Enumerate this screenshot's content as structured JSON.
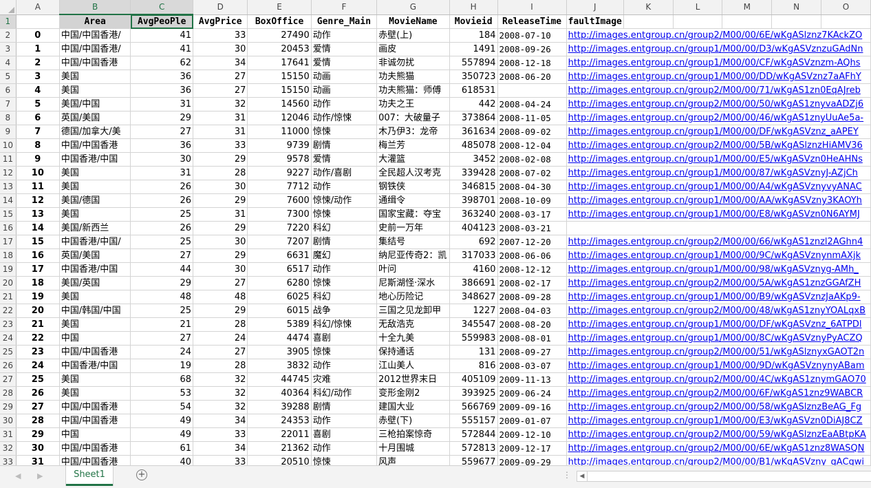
{
  "column_letters": [
    "A",
    "B",
    "C",
    "D",
    "E",
    "F",
    "G",
    "H",
    "I",
    "J",
    "K",
    "L",
    "M",
    "N",
    "O"
  ],
  "header_row": {
    "row_number": "1",
    "cells": [
      "",
      "Area",
      "AvgPeoPle",
      "AvgPrice",
      "BoxOffice",
      "Genre_Main",
      "MovieName",
      "Movieid",
      "ReleaseTime",
      "faultImage"
    ]
  },
  "rows": [
    {
      "r": "2",
      "idx": "0",
      "area": "中国/中国香港/",
      "ppl": "41",
      "price": "33",
      "box": "27490",
      "genre": "动作",
      "name": "赤壁(上)",
      "id": "184",
      "date": "2008-07-10",
      "img": "http://images.entgroup.cn/group2/M00/00/6E/wKgASlznz7KAckZO"
    },
    {
      "r": "3",
      "idx": "1",
      "area": "中国/中国香港/",
      "ppl": "41",
      "price": "30",
      "box": "20453",
      "genre": "爱情",
      "name": "画皮",
      "id": "1491",
      "date": "2008-09-26",
      "img": "http://images.entgroup.cn/group1/M00/00/D3/wKgASVznzuGAdNn"
    },
    {
      "r": "4",
      "idx": "2",
      "area": "中国/中国香港",
      "ppl": "62",
      "price": "34",
      "box": "17641",
      "genre": "爱情",
      "name": "非诚勿扰",
      "id": "557894",
      "date": "2008-12-18",
      "img": "http://images.entgroup.cn/group1/M00/00/CF/wKgASVznzm-AQhs"
    },
    {
      "r": "5",
      "idx": "3",
      "area": "美国",
      "ppl": "36",
      "price": "27",
      "box": "15150",
      "genre": "动画",
      "name": "功夫熊猫",
      "id": "350723",
      "date": "2008-06-20",
      "img": "http://images.entgroup.cn/group1/M00/00/DD/wKgASVznz7aAFhY"
    },
    {
      "r": "6",
      "idx": "4",
      "area": "美国",
      "ppl": "36",
      "price": "27",
      "box": "15150",
      "genre": "动画",
      "name": "功夫熊猫：师傅",
      "id": "618531",
      "date": "",
      "img": "http://images.entgroup.cn/group2/M00/00/71/wKgAS1zn0EqAJreb"
    },
    {
      "r": "7",
      "idx": "5",
      "area": "美国/中国",
      "ppl": "31",
      "price": "32",
      "box": "14560",
      "genre": "动作",
      "name": "功夫之王",
      "id": "442",
      "date": "2008-04-24",
      "img": "http://images.entgroup.cn/group2/M00/00/50/wKgAS1znyvaADZj6"
    },
    {
      "r": "8",
      "idx": "6",
      "area": "英国/美国",
      "ppl": "29",
      "price": "31",
      "box": "12046",
      "genre": "动作/惊悚",
      "name": "007：大破量子",
      "id": "373864",
      "date": "2008-11-05",
      "img": "http://images.entgroup.cn/group2/M00/00/46/wKgAS1znyUuAe5a-"
    },
    {
      "r": "9",
      "idx": "7",
      "area": "德国/加拿大/美",
      "ppl": "27",
      "price": "31",
      "box": "11000",
      "genre": "惊悚",
      "name": "木乃伊3：龙帝",
      "id": "361634",
      "date": "2008-09-02",
      "img": "http://images.entgroup.cn/group1/M00/00/DF/wKgASVznz_aAPEY"
    },
    {
      "r": "10",
      "idx": "8",
      "area": "中国/中国香港",
      "ppl": "36",
      "price": "33",
      "box": "9739",
      "genre": "剧情",
      "name": "梅兰芳",
      "id": "485078",
      "date": "2008-12-04",
      "img": "http://images.entgroup.cn/group2/M00/00/5B/wKgASlznzHiAMV36"
    },
    {
      "r": "11",
      "idx": "9",
      "area": "中国香港/中国",
      "ppl": "30",
      "price": "29",
      "box": "9578",
      "genre": "爱情",
      "name": "大灌篮",
      "id": "3452",
      "date": "2008-02-08",
      "img": "http://images.entgroup.cn/group1/M00/00/E5/wKgASVzn0HeAHNs"
    },
    {
      "r": "12",
      "idx": "10",
      "area": "美国",
      "ppl": "31",
      "price": "28",
      "box": "9227",
      "genre": "动作/喜剧",
      "name": "全民超人汉考克",
      "id": "339428",
      "date": "2008-07-02",
      "img": "http://images.entgroup.cn/group1/M00/00/87/wKgASVznyJ-AZjCh"
    },
    {
      "r": "13",
      "idx": "11",
      "area": "美国",
      "ppl": "26",
      "price": "30",
      "box": "7712",
      "genre": "动作",
      "name": "钢铁侠",
      "id": "346815",
      "date": "2008-04-30",
      "img": "http://images.entgroup.cn/group1/M00/00/A4/wKgASVznyvyANAC"
    },
    {
      "r": "14",
      "idx": "12",
      "area": "美国/德国",
      "ppl": "26",
      "price": "29",
      "box": "7600",
      "genre": "惊悚/动作",
      "name": "通缉令",
      "id": "398701",
      "date": "2008-10-09",
      "img": "http://images.entgroup.cn/group1/M00/00/AA/wKgASVzny3KAOYh"
    },
    {
      "r": "15",
      "idx": "13",
      "area": "美国",
      "ppl": "25",
      "price": "31",
      "box": "7300",
      "genre": "惊悚",
      "name": "国家宝藏：夺宝",
      "id": "363240",
      "date": "2008-03-17",
      "img": "http://images.entgroup.cn/group1/M00/00/E8/wKgASVzn0N6AYMJ"
    },
    {
      "r": "16",
      "idx": "14",
      "area": "美国/新西兰",
      "ppl": "26",
      "price": "29",
      "box": "7220",
      "genre": "科幻",
      "name": "史前一万年",
      "id": "404123",
      "date": "2008-03-21",
      "img": ""
    },
    {
      "r": "17",
      "idx": "15",
      "area": "中国香港/中国/",
      "ppl": "25",
      "price": "30",
      "box": "7207",
      "genre": "剧情",
      "name": "集结号",
      "id": "692",
      "date": "2007-12-20",
      "img": "http://images.entgroup.cn/group2/M00/00/66/wKgAS1znzl2AGhn4"
    },
    {
      "r": "18",
      "idx": "16",
      "area": "英国/美国",
      "ppl": "27",
      "price": "29",
      "box": "6631",
      "genre": "魔幻",
      "name": "纳尼亚传奇2：凯",
      "id": "317033",
      "date": "2008-06-06",
      "img": "http://images.entgroup.cn/group1/M00/00/9C/wKgASVznynmAXjk"
    },
    {
      "r": "19",
      "idx": "17",
      "area": "中国香港/中国",
      "ppl": "44",
      "price": "30",
      "box": "6517",
      "genre": "动作",
      "name": "叶问",
      "id": "4160",
      "date": "2008-12-12",
      "img": "http://images.entgroup.cn/group1/M00/00/98/wKgASVznyg-AMh_"
    },
    {
      "r": "20",
      "idx": "18",
      "area": "美国/英国",
      "ppl": "29",
      "price": "27",
      "box": "6280",
      "genre": "惊悚",
      "name": "尼斯湖怪·深水",
      "id": "386691",
      "date": "2008-02-17",
      "img": "http://images.entgroup.cn/group2/M00/00/5A/wKgAS1znzGGAfZH"
    },
    {
      "r": "21",
      "idx": "19",
      "area": "美国",
      "ppl": "48",
      "price": "48",
      "box": "6025",
      "genre": "科幻",
      "name": "地心历险记",
      "id": "348627",
      "date": "2008-09-28",
      "img": "http://images.entgroup.cn/group1/M00/00/B9/wKgASVznzJaAKp9-"
    },
    {
      "r": "22",
      "idx": "20",
      "area": "中国/韩国/中国",
      "ppl": "25",
      "price": "29",
      "box": "6015",
      "genre": "战争",
      "name": "三国之见龙卸甲",
      "id": "1227",
      "date": "2008-04-03",
      "img": "http://images.entgroup.cn/group2/M00/00/48/wKgAS1znyYOALqxB"
    },
    {
      "r": "23",
      "idx": "21",
      "area": "美国",
      "ppl": "21",
      "price": "28",
      "box": "5389",
      "genre": "科幻/惊悚",
      "name": "无敌浩克",
      "id": "345547",
      "date": "2008-08-20",
      "img": "http://images.entgroup.cn/group1/M00/00/DF/wKgASVznz_6ATPDl"
    },
    {
      "r": "24",
      "idx": "22",
      "area": "中国",
      "ppl": "27",
      "price": "24",
      "box": "4474",
      "genre": "喜剧",
      "name": "十全九美",
      "id": "559983",
      "date": "2008-08-01",
      "img": "http://images.entgroup.cn/group1/M00/00/8C/wKgASVznyPyACZQ"
    },
    {
      "r": "25",
      "idx": "23",
      "area": "中国/中国香港",
      "ppl": "24",
      "price": "27",
      "box": "3905",
      "genre": "惊悚",
      "name": "保持通话",
      "id": "131",
      "date": "2008-09-27",
      "img": "http://images.entgroup.cn/group2/M00/00/51/wKgASlznyxGAOT2n"
    },
    {
      "r": "26",
      "idx": "24",
      "area": "中国香港/中国",
      "ppl": "19",
      "price": "28",
      "box": "3832",
      "genre": "动作",
      "name": "江山美人",
      "id": "816",
      "date": "2008-03-07",
      "img": "http://images.entgroup.cn/group1/M00/00/9D/wKgASVznynyABam"
    },
    {
      "r": "27",
      "idx": "25",
      "area": "美国",
      "ppl": "68",
      "price": "32",
      "box": "44745",
      "genre": "灾难",
      "name": "2012世界末日",
      "id": "405109",
      "date": "2009-11-13",
      "img": "http://images.entgroup.cn/group2/M00/00/4C/wKgAS1znymGAO70"
    },
    {
      "r": "28",
      "idx": "26",
      "area": "美国",
      "ppl": "53",
      "price": "32",
      "box": "40364",
      "genre": "科幻/动作",
      "name": "变形金刚2",
      "id": "393925",
      "date": "2009-06-24",
      "img": "http://images.entgroup.cn/group2/M00/00/6F/wKgAS1znz9WABCR"
    },
    {
      "r": "29",
      "idx": "27",
      "area": "中国/中国香港",
      "ppl": "54",
      "price": "32",
      "box": "39288",
      "genre": "剧情",
      "name": "建国大业",
      "id": "566769",
      "date": "2009-09-16",
      "img": "http://images.entgroup.cn/group2/M00/00/58/wKgASlznzBeAG_Fg"
    },
    {
      "r": "30",
      "idx": "28",
      "area": "中国/中国香港",
      "ppl": "49",
      "price": "34",
      "box": "24353",
      "genre": "动作",
      "name": "赤壁(下)",
      "id": "555157",
      "date": "2009-01-07",
      "img": "http://images.entgroup.cn/group1/M00/00/E3/wKgASVzn0DiAJ8CZ"
    },
    {
      "r": "31",
      "idx": "29",
      "area": "中国",
      "ppl": "49",
      "price": "33",
      "box": "22011",
      "genre": "喜剧",
      "name": "三枪拍案惊奇",
      "id": "572844",
      "date": "2009-12-10",
      "img": "http://images.entgroup.cn/group2/M00/00/59/wKgASlznzEaABtpKA"
    },
    {
      "r": "32",
      "idx": "30",
      "area": "中国/中国香港",
      "ppl": "61",
      "price": "34",
      "box": "21362",
      "genre": "动作",
      "name": "十月围城",
      "id": "572813",
      "date": "2009-12-17",
      "img": "http://images.entgroup.cn/group2/M00/00/6E/wKgAS1znz8WASQN"
    },
    {
      "r": "33",
      "idx": "31",
      "area": "中国/中国香港",
      "ppl": "40",
      "price": "33",
      "box": "20510",
      "genre": "惊悚",
      "name": "风声",
      "id": "559677",
      "date": "2009-09-29",
      "img": "http://images.entgroup.cn/group2/M00/00/B1/wKgASVzny_gACgwi"
    }
  ],
  "sheet_tabs": [
    "Sheet1"
  ],
  "statusbar": {
    "add_sheet": "⊕",
    "nav_prev": "◀",
    "nav_next": "▶",
    "more": "⋮",
    "scroll_left": "◀"
  }
}
